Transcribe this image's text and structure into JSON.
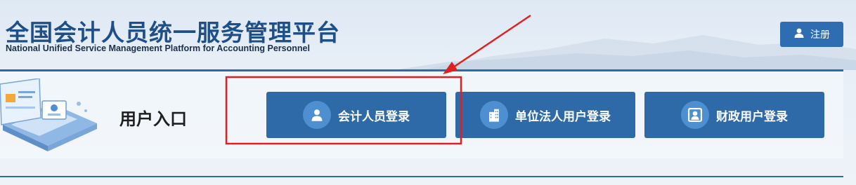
{
  "header": {
    "title_cn": "全国会计人员统一服务管理平台",
    "title_en": "National Unified Service Management Platform for Accounting Personnel",
    "register": {
      "label": "注册",
      "icon": "user-icon"
    }
  },
  "entry": {
    "label": "用户入口",
    "buttons": [
      {
        "label": "会计人员登录",
        "icon": "person-icon"
      },
      {
        "label": "单位法人用户登录",
        "icon": "building-icon"
      },
      {
        "label": "财政用户登录",
        "icon": "portrait-icon"
      }
    ]
  },
  "colors": {
    "brand_title": "#1f4f89",
    "button": "#2f6aa8",
    "icon_circle": "#4e8fd1",
    "annotation": "#e02020"
  }
}
